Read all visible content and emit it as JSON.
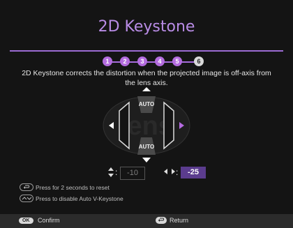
{
  "header": {
    "title": "2D Keystone"
  },
  "steps": [
    "1",
    "2",
    "3",
    "4",
    "5",
    "6"
  ],
  "description": "2D Keystone corrects the distortion when the projected image is off-axis from the lens axis.",
  "diagram": {
    "top_label": "AUTO",
    "bottom_label": "AUTO",
    "bg_word": "lens"
  },
  "vertical": {
    "value": "-10"
  },
  "horizontal": {
    "value": "-25"
  },
  "hints": {
    "reset": "Press for 2 seconds to reset",
    "disable": "Press to disable Auto V-Keystone"
  },
  "footer": {
    "ok_label": "OK",
    "confirm": "Confirm",
    "return": "Return"
  },
  "colors": {
    "accent": "#b98ce6",
    "step_active": "#b36cde",
    "value_active_bg": "#5b3c8e"
  },
  "icons": [
    "up-arrow-icon",
    "down-arrow-icon",
    "left-arrow-icon",
    "right-arrow-icon",
    "vertical-arrows-icon",
    "horizontal-arrows-icon",
    "back-icon",
    "up-down-icon",
    "return-icon"
  ]
}
